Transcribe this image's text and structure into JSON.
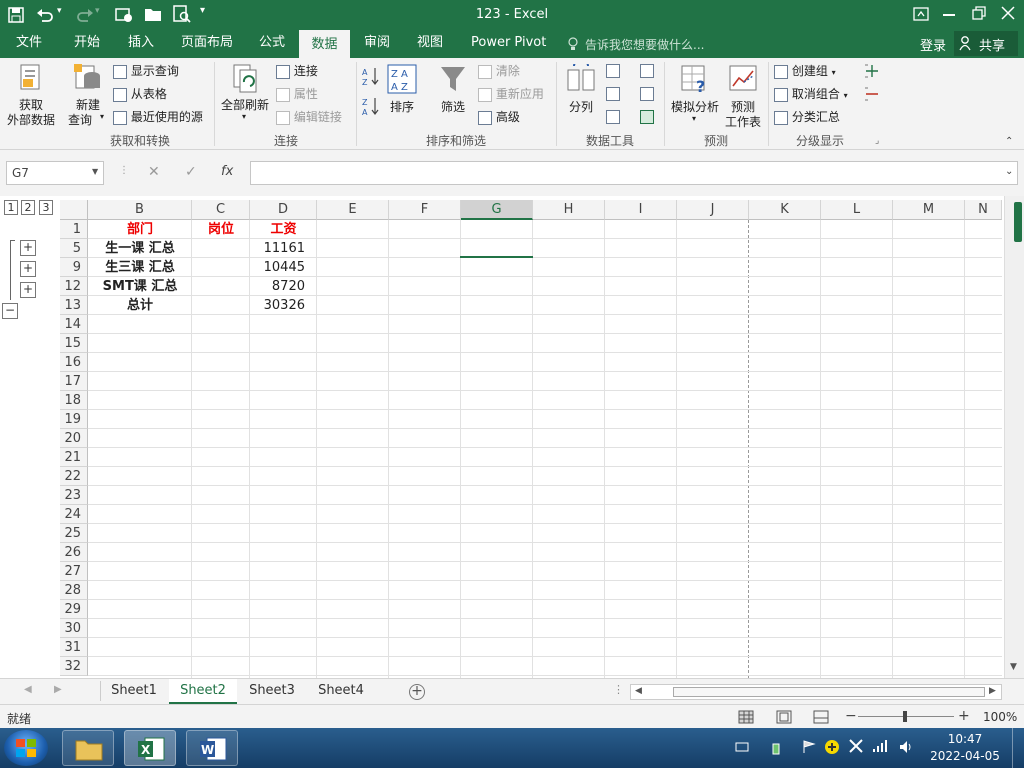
{
  "window": {
    "title": "123  -  Excel"
  },
  "quick_access": {
    "save_icon": "save-icon",
    "undo_icon": "undo-icon",
    "redo_icon": "redo-icon",
    "touch_icon": "touch-mode-icon",
    "open_icon": "folder-icon",
    "preview_icon": "print-preview-icon",
    "more_icon": "customize-icon"
  },
  "ribbon_tabs": [
    "文件",
    "开始",
    "插入",
    "页面布局",
    "公式",
    "数据",
    "审阅",
    "视图",
    "Power Pivot"
  ],
  "active_tab": "数据",
  "tell_me": "告诉我您想要做什么...",
  "account": {
    "login": "登录",
    "share": "共享"
  },
  "ribbon": {
    "get_transform": {
      "get_external_line1": "获取",
      "get_external_line2": "外部数据",
      "new_query_line1": "新建",
      "new_query_line2": "查询",
      "show_queries": "显示查询",
      "from_table": "从表格",
      "recent_sources": "最近使用的源",
      "label": "获取和转换"
    },
    "connections": {
      "refresh_all": "全部刷新",
      "connections": "连接",
      "properties": "属性",
      "edit_links": "编辑链接",
      "label": "连接"
    },
    "sort_filter": {
      "sort": "排序",
      "filter": "筛选",
      "clear": "清除",
      "reapply": "重新应用",
      "advanced": "高级",
      "label": "排序和筛选"
    },
    "data_tools": {
      "split": "分列",
      "label": "数据工具"
    },
    "forecast": {
      "what_if": "模拟分析",
      "forecast_line1": "预测",
      "forecast_line2": "工作表",
      "label": "预测"
    },
    "outline": {
      "group": "创建组",
      "ungroup": "取消组合",
      "subtotal": "分类汇总",
      "label": "分级显示"
    }
  },
  "formula_bar": {
    "name_box": "G7",
    "cancel": "✕",
    "enter": "✓",
    "fx": "fx",
    "value": ""
  },
  "outline_levels": [
    "1",
    "2",
    "3"
  ],
  "columns": [
    "B",
    "C",
    "D",
    "E",
    "F",
    "G",
    "H",
    "I",
    "J",
    "K",
    "L",
    "M",
    "N"
  ],
  "selected_column": "G",
  "rows": [
    {
      "num": "1",
      "B": "部门",
      "C": "岗位",
      "D": "工资",
      "type": "header"
    },
    {
      "num": "5",
      "B": "生一课 汇总",
      "C": "",
      "D": "11161",
      "type": "subtotal"
    },
    {
      "num": "9",
      "B": "生三课 汇总",
      "C": "",
      "D": "10445",
      "type": "subtotal"
    },
    {
      "num": "12",
      "B": "SMT课 汇总",
      "C": "",
      "D": "8720",
      "type": "subtotal"
    },
    {
      "num": "13",
      "B": "总计",
      "C": "",
      "D": "30326",
      "type": "total"
    },
    {
      "num": "14"
    },
    {
      "num": "15"
    },
    {
      "num": "16"
    },
    {
      "num": "17"
    },
    {
      "num": "18"
    },
    {
      "num": "19"
    },
    {
      "num": "20"
    },
    {
      "num": "21"
    },
    {
      "num": "22"
    },
    {
      "num": "23"
    },
    {
      "num": "24"
    },
    {
      "num": "25"
    },
    {
      "num": "26"
    },
    {
      "num": "27"
    },
    {
      "num": "28"
    },
    {
      "num": "29"
    },
    {
      "num": "30"
    },
    {
      "num": "31"
    },
    {
      "num": "32"
    }
  ],
  "outline_buttons": [
    "+",
    "+",
    "+",
    "−"
  ],
  "sheets": [
    "Sheet1",
    "Sheet2",
    "Sheet3",
    "Sheet4"
  ],
  "active_sheet": "Sheet2",
  "status": {
    "ready": "就绪",
    "zoom": "100%"
  },
  "taskbar": {
    "time": "10:47",
    "date": "2022-04-05"
  },
  "colors": {
    "excel_green": "#217346",
    "header_red": "#ee0000"
  }
}
